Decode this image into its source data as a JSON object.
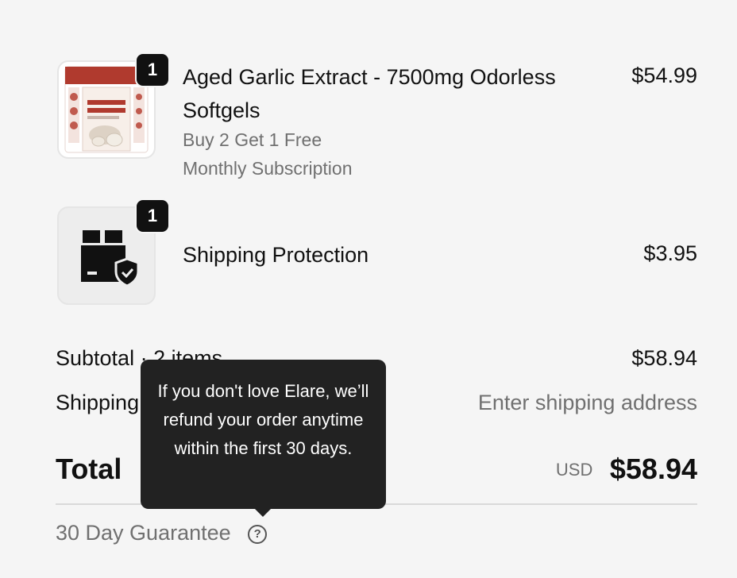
{
  "items": [
    {
      "quantity": "1",
      "name": "Aged Garlic Extract - 7500mg Odorless Softgels",
      "variant": "Buy 2 Get 1 Free",
      "plan": "Monthly Subscription",
      "price": "$54.99",
      "image_icon": "product-box-garlic",
      "image_brand": "Elare",
      "image_banner": "FREE EXCLUSIVE E-BOOK WITH EVERY ORDER TODAY!",
      "image_title": "Odorless Aged Garlic Extract"
    },
    {
      "quantity": "1",
      "name": "Shipping Protection",
      "price": "$3.95",
      "image_icon": "package-shield-icon"
    }
  ],
  "summary": {
    "subtotal_label": "Subtotal · 2 items",
    "subtotal_value": "$58.94",
    "shipping_label": "Shipping",
    "shipping_value": "Enter shipping address",
    "total_label": "Total",
    "currency": "USD",
    "total_value": "$58.94"
  },
  "guarantee": {
    "label": "30 Day Guarantee",
    "tooltip": "If you don't love Elare, we’ll refund your order anytime within the first 30 days."
  },
  "colors": {
    "background": "#f5f5f5",
    "tooltip_bg": "#222222",
    "muted_text": "#707070",
    "brand_red": "#b03a2e"
  }
}
